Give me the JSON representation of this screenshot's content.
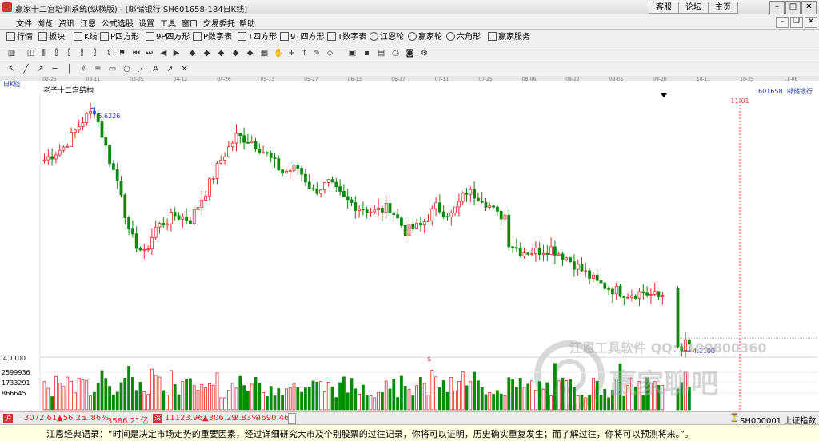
{
  "window": {
    "title": "赢家十二宫培训系统(纵横版) - [邮储银行 SH601658-184日K线]",
    "buttons": [
      "客服",
      "论坛",
      "主页"
    ]
  },
  "menu": [
    "文件",
    "浏览",
    "资讯",
    "江恩",
    "公式选股",
    "设置",
    "工具",
    "窗口",
    "交易委托",
    "帮助"
  ],
  "toolbar1": [
    "行情",
    "板块",
    "K线",
    "P四方形",
    "9P四方形",
    "P数字表",
    "T四方形",
    "9T四方形",
    "T数字表",
    "江恩轮",
    "赢家轮",
    "六角形",
    "赢家服务"
  ],
  "chart_panel": {
    "period_label": "日K线",
    "indicator_title": "老子十二宫结构",
    "stock_code": "601658",
    "stock_name": "邮储银行",
    "marker_date": "11-01",
    "watermark_text": "江恩工具软件 QQ:1100800360",
    "watermark_logo": "赢家聊吧"
  },
  "status": {
    "sh_index": "3072.61",
    "sh_change": "▲56.25",
    "sh_pct": "1.86%",
    "sh_amount": "3586.21亿",
    "sz_index": "11123.96",
    "sz_change": "▲306.29",
    "sz_pct": "2.83%",
    "sz_amount": "4690.46",
    "index_link": "SH000001 上证指数"
  },
  "quote": "江恩经典语录：“时间是决定市场走势的重要因素，经过详细研究大市及个别股票的过往记录，你将可以证明，历史确实重复发生；而了解过往，你将可以预测将来。”。",
  "colors": {
    "up": "#e5262b",
    "down": "#0a8a0a",
    "annotation": "#3434c8",
    "marker": "#e04040"
  },
  "chart_data": {
    "type": "candlestick",
    "date_ticks": [
      "02-25",
      "03-11",
      "03-25",
      "04-12",
      "04-26",
      "05-13",
      "05-27",
      "06-13",
      "06-27",
      "07-11",
      "07-25",
      "08-08",
      "08-22",
      "09-05",
      "09-20",
      "10-11",
      "10-25",
      "11-08",
      "11-22"
    ],
    "price_annotations": {
      "high": "5.6226",
      "low": "4.1100",
      "scale_label": "4.1100"
    },
    "price_range": [
      4.05,
      5.72
    ],
    "volume_ticks": [
      "2599936",
      "1733291",
      "866645"
    ],
    "volume_max": 3000000,
    "volume_marker": "$",
    "candle_count": 184,
    "candle_count_drawn": 162,
    "anchor_closes": [
      {
        "i": 0,
        "v": 5.3
      },
      {
        "i": 5,
        "v": 5.38
      },
      {
        "i": 10,
        "v": 5.55
      },
      {
        "i": 13,
        "v": 5.62
      },
      {
        "i": 17,
        "v": 5.3
      },
      {
        "i": 20,
        "v": 5.1
      },
      {
        "i": 22,
        "v": 4.83
      },
      {
        "i": 26,
        "v": 4.7
      },
      {
        "i": 29,
        "v": 4.87
      },
      {
        "i": 34,
        "v": 4.95
      },
      {
        "i": 38,
        "v": 4.92
      },
      {
        "i": 42,
        "v": 5.1
      },
      {
        "i": 46,
        "v": 5.3
      },
      {
        "i": 50,
        "v": 5.45
      },
      {
        "i": 54,
        "v": 5.42
      },
      {
        "i": 58,
        "v": 5.33
      },
      {
        "i": 62,
        "v": 5.22
      },
      {
        "i": 66,
        "v": 5.25
      },
      {
        "i": 70,
        "v": 5.1
      },
      {
        "i": 74,
        "v": 5.15
      },
      {
        "i": 78,
        "v": 5.05
      },
      {
        "i": 82,
        "v": 5.0
      },
      {
        "i": 86,
        "v": 4.97
      },
      {
        "i": 90,
        "v": 5.0
      },
      {
        "i": 94,
        "v": 4.85
      },
      {
        "i": 98,
        "v": 4.88
      },
      {
        "i": 102,
        "v": 5.0
      },
      {
        "i": 106,
        "v": 4.95
      },
      {
        "i": 110,
        "v": 5.1
      },
      {
        "i": 114,
        "v": 5.06
      },
      {
        "i": 118,
        "v": 4.95
      },
      {
        "i": 120,
        "v": 4.95
      },
      {
        "i": 121,
        "v": 4.78
      },
      {
        "i": 124,
        "v": 4.72
      },
      {
        "i": 128,
        "v": 4.72
      },
      {
        "i": 132,
        "v": 4.74
      },
      {
        "i": 136,
        "v": 4.68
      },
      {
        "i": 140,
        "v": 4.6
      },
      {
        "i": 144,
        "v": 4.52
      },
      {
        "i": 148,
        "v": 4.48
      },
      {
        "i": 152,
        "v": 4.45
      },
      {
        "i": 156,
        "v": 4.46
      },
      {
        "i": 160,
        "v": 4.43
      },
      {
        "i": 164,
        "v": 4.5
      },
      {
        "i": 168,
        "v": 4.55
      },
      {
        "i": 172,
        "v": 4.53
      },
      {
        "i": 176,
        "v": 4.55
      },
      {
        "i": 179,
        "v": 4.46
      },
      {
        "i": 180,
        "v": 4.12
      },
      {
        "i": 183,
        "v": 4.13
      }
    ]
  }
}
